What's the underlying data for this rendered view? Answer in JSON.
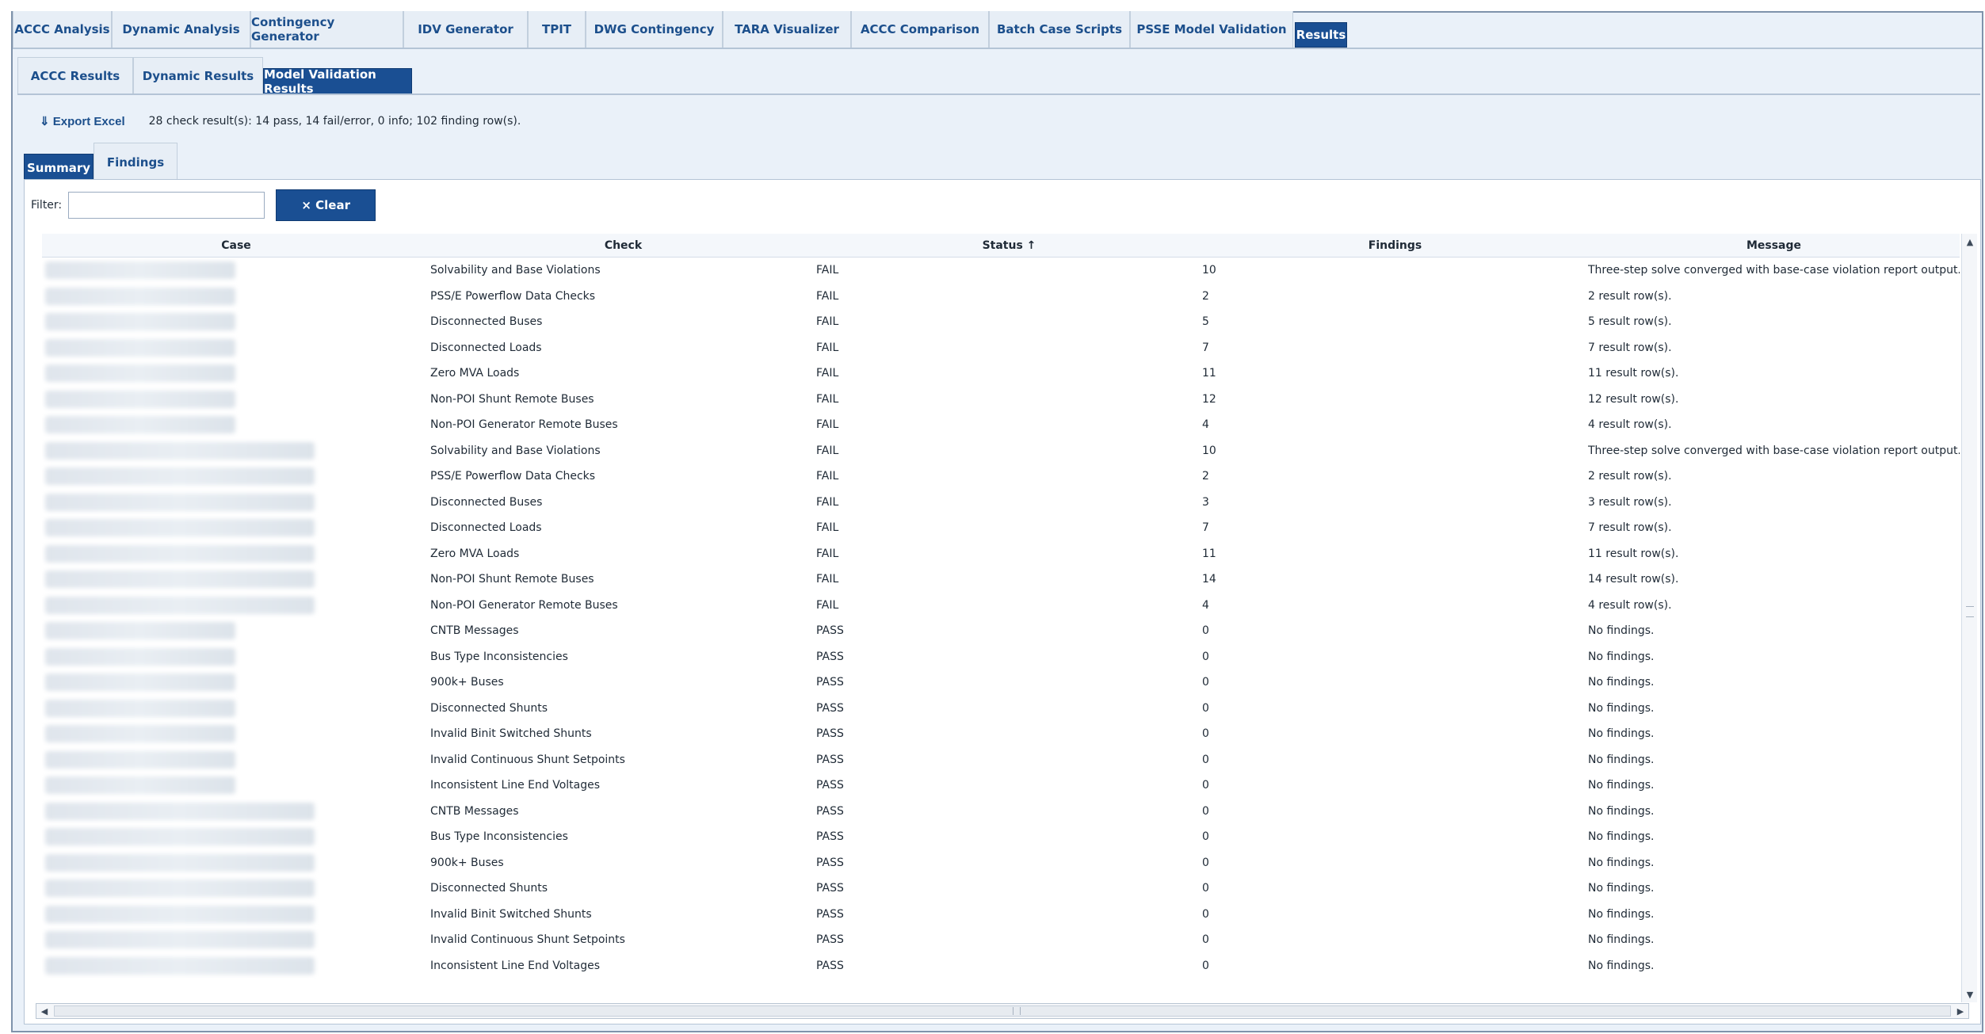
{
  "top_tabs": [
    {
      "label": "ACCC Analysis",
      "active": false
    },
    {
      "label": "Dynamic Analysis",
      "active": false
    },
    {
      "label": "Contingency Generator",
      "active": false
    },
    {
      "label": "IDV Generator",
      "active": false
    },
    {
      "label": "TPIT",
      "active": false
    },
    {
      "label": "DWG Contingency",
      "active": false
    },
    {
      "label": "TARA Visualizer",
      "active": false
    },
    {
      "label": "ACCC Comparison",
      "active": false
    },
    {
      "label": "Batch Case Scripts",
      "active": false
    },
    {
      "label": "PSSE Model Validation",
      "active": false
    },
    {
      "label": "Results",
      "active": true
    }
  ],
  "sub_tabs": [
    {
      "label": "ACCC Results",
      "active": false
    },
    {
      "label": "Dynamic Results",
      "active": false
    },
    {
      "label": "Model Validation Results",
      "active": true
    }
  ],
  "toolbar": {
    "export_icon": "download-arrow-icon",
    "export_label": "⇓ Export Excel",
    "summary": "28 check result(s): 14 pass, 14 fail/error, 0 info; 102 finding row(s)."
  },
  "inner_tabs": [
    {
      "label": "Summary",
      "active": true
    },
    {
      "label": "Findings",
      "active": false
    }
  ],
  "filter": {
    "label": "Filter:",
    "value": "",
    "placeholder": "",
    "clear_label": "× Clear"
  },
  "grid": {
    "columns": [
      "Case",
      "Check",
      "Status ↑",
      "Findings",
      "Message"
    ],
    "rows": [
      {
        "case_blur": 1,
        "check": "Solvability and Base Violations",
        "status": "FAIL",
        "findings": "10",
        "message": "Three-step solve converged with base-case violation report output."
      },
      {
        "case_blur": 1,
        "check": "PSS/E Powerflow Data Checks",
        "status": "FAIL",
        "findings": "2",
        "message": "2 result row(s)."
      },
      {
        "case_blur": 1,
        "check": "Disconnected Buses",
        "status": "FAIL",
        "findings": "5",
        "message": "5 result row(s)."
      },
      {
        "case_blur": 1,
        "check": "Disconnected Loads",
        "status": "FAIL",
        "findings": "7",
        "message": "7 result row(s)."
      },
      {
        "case_blur": 1,
        "check": "Zero MVA Loads",
        "status": "FAIL",
        "findings": "11",
        "message": "11 result row(s)."
      },
      {
        "case_blur": 1,
        "check": "Non-POI Shunt Remote Buses",
        "status": "FAIL",
        "findings": "12",
        "message": "12 result row(s)."
      },
      {
        "case_blur": 1,
        "check": "Non-POI Generator Remote Buses",
        "status": "FAIL",
        "findings": "4",
        "message": "4 result row(s)."
      },
      {
        "case_blur": 2,
        "check": "Solvability and Base Violations",
        "status": "FAIL",
        "findings": "10",
        "message": "Three-step solve converged with base-case violation report output."
      },
      {
        "case_blur": 2,
        "check": "PSS/E Powerflow Data Checks",
        "status": "FAIL",
        "findings": "2",
        "message": "2 result row(s)."
      },
      {
        "case_blur": 2,
        "check": "Disconnected Buses",
        "status": "FAIL",
        "findings": "3",
        "message": "3 result row(s)."
      },
      {
        "case_blur": 2,
        "check": "Disconnected Loads",
        "status": "FAIL",
        "findings": "7",
        "message": "7 result row(s)."
      },
      {
        "case_blur": 2,
        "check": "Zero MVA Loads",
        "status": "FAIL",
        "findings": "11",
        "message": "11 result row(s)."
      },
      {
        "case_blur": 2,
        "check": "Non-POI Shunt Remote Buses",
        "status": "FAIL",
        "findings": "14",
        "message": "14 result row(s)."
      },
      {
        "case_blur": 2,
        "check": "Non-POI Generator Remote Buses",
        "status": "FAIL",
        "findings": "4",
        "message": "4 result row(s)."
      },
      {
        "case_blur": 1,
        "check": "CNTB Messages",
        "status": "PASS",
        "findings": "0",
        "message": "No findings."
      },
      {
        "case_blur": 1,
        "check": "Bus Type Inconsistencies",
        "status": "PASS",
        "findings": "0",
        "message": "No findings."
      },
      {
        "case_blur": 1,
        "check": "900k+ Buses",
        "status": "PASS",
        "findings": "0",
        "message": "No findings."
      },
      {
        "case_blur": 1,
        "check": "Disconnected Shunts",
        "status": "PASS",
        "findings": "0",
        "message": "No findings."
      },
      {
        "case_blur": 1,
        "check": "Invalid Binit Switched Shunts",
        "status": "PASS",
        "findings": "0",
        "message": "No findings."
      },
      {
        "case_blur": 1,
        "check": "Invalid Continuous Shunt Setpoints",
        "status": "PASS",
        "findings": "0",
        "message": "No findings."
      },
      {
        "case_blur": 1,
        "check": "Inconsistent Line End Voltages",
        "status": "PASS",
        "findings": "0",
        "message": "No findings."
      },
      {
        "case_blur": 2,
        "check": "CNTB Messages",
        "status": "PASS",
        "findings": "0",
        "message": "No findings."
      },
      {
        "case_blur": 2,
        "check": "Bus Type Inconsistencies",
        "status": "PASS",
        "findings": "0",
        "message": "No findings."
      },
      {
        "case_blur": 2,
        "check": "900k+ Buses",
        "status": "PASS",
        "findings": "0",
        "message": "No findings."
      },
      {
        "case_blur": 2,
        "check": "Disconnected Shunts",
        "status": "PASS",
        "findings": "0",
        "message": "No findings."
      },
      {
        "case_blur": 2,
        "check": "Invalid Binit Switched Shunts",
        "status": "PASS",
        "findings": "0",
        "message": "No findings."
      },
      {
        "case_blur": 2,
        "check": "Invalid Continuous Shunt Setpoints",
        "status": "PASS",
        "findings": "0",
        "message": "No findings."
      },
      {
        "case_blur": 2,
        "check": "Inconsistent Line End Voltages",
        "status": "PASS",
        "findings": "0",
        "message": "No findings."
      }
    ]
  },
  "scrollbars": {
    "up_icon": "▲",
    "down_icon": "▼",
    "left_icon": "◀",
    "right_icon": "▶"
  },
  "colors": {
    "accent": "#1a4f93",
    "tab_text": "#1c4f8c",
    "frame_bg": "#eaf1f9"
  }
}
